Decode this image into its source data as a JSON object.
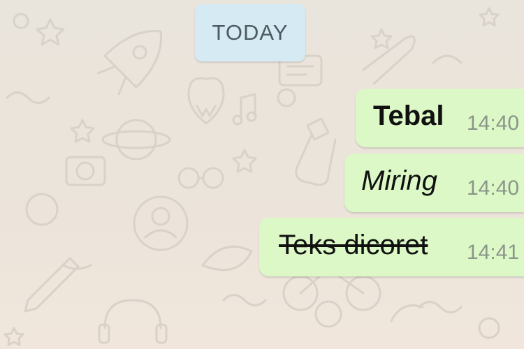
{
  "chat": {
    "date_separator": "TODAY",
    "messages": [
      {
        "text": "Tebal",
        "time": "14:40",
        "style": "bold"
      },
      {
        "text": "Miring",
        "time": "14:40",
        "style": "italic"
      },
      {
        "text": "Teks dicoret",
        "time": "14:41",
        "style": "strikethrough"
      }
    ]
  },
  "colors": {
    "background": "#ece5dd",
    "outgoing_bubble": "#dcf8c6",
    "date_chip": "#d5eaf3"
  },
  "icons": [
    "doodle-wallpaper"
  ]
}
